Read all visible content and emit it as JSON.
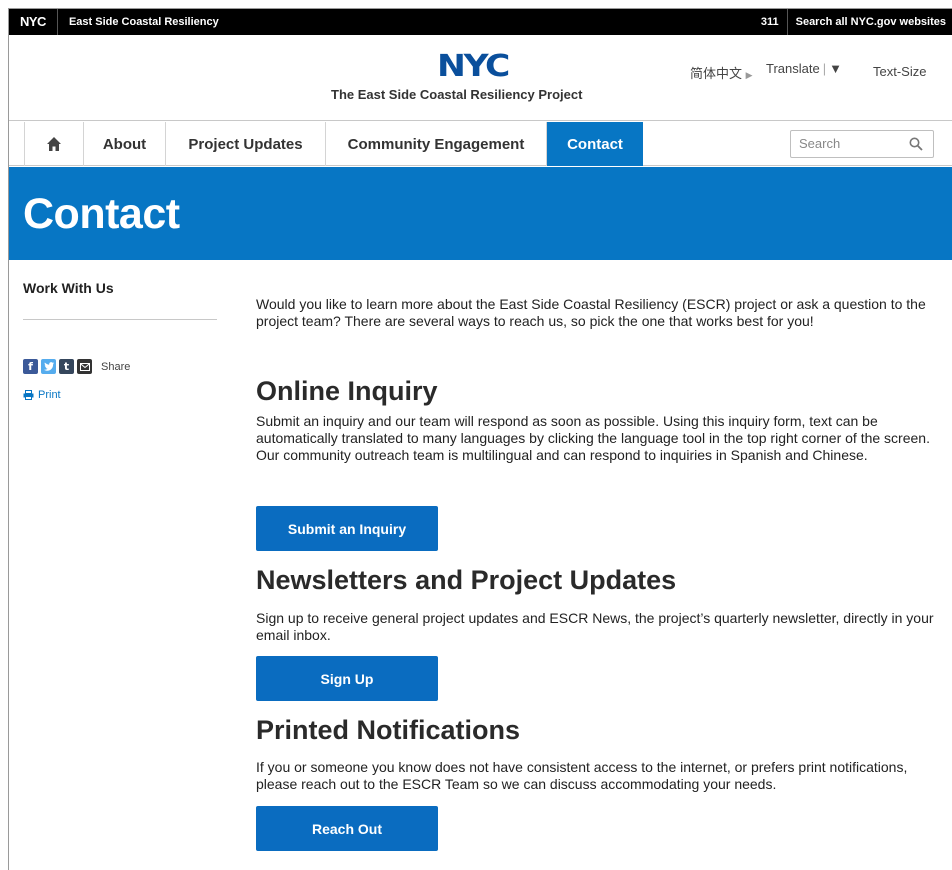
{
  "topbar": {
    "logo": "NYC",
    "site_name": "East Side Coastal Resiliency",
    "link_311": "311",
    "search_all": "Search all NYC.gov websites"
  },
  "header": {
    "logo": "NYC",
    "project_title": "The East Side Coastal Resiliency Project",
    "language": "简体中文",
    "translate": "Translate",
    "text_size": "Text-Size"
  },
  "nav": {
    "items": [
      {
        "label": "About"
      },
      {
        "label": "Project Updates"
      },
      {
        "label": "Community Engagement"
      },
      {
        "label": "Contact"
      }
    ],
    "active": "Contact",
    "search_placeholder": "Search"
  },
  "banner": {
    "title": "Contact"
  },
  "sidebar": {
    "title": "Work With Us",
    "share_label": "Share",
    "print_label": "Print"
  },
  "main": {
    "intro": "Would you like to learn more about the East Side Coastal Resiliency (ESCR) project or ask a question to the project team? There are several ways to reach us, so pick the one that works best for you!",
    "sections": [
      {
        "heading": "Online Inquiry",
        "text": "Submit an inquiry and our team will respond as soon as possible. Using this inquiry form, text can be automatically translated to many languages by clicking the language tool in the top right corner of the screen. Our community outreach team is multilingual and can respond to inquiries in Spanish and Chinese.",
        "button": "Submit an Inquiry"
      },
      {
        "heading": "Newsletters and Project Updates",
        "text": "Sign up to receive general project updates and ESCR News, the project’s quarterly newsletter, directly in your email inbox.",
        "button": "Sign Up"
      },
      {
        "heading": "Printed Notifications",
        "text": "If you or someone you know does not have consistent access to the internet, or prefers print notifications, please reach out to the ESCR Team so we can discuss accommodating your needs.",
        "button": "Reach Out"
      }
    ]
  },
  "colors": {
    "brand_blue": "#0776c4",
    "button_blue": "#0a6cc0",
    "logo_blue": "#0a4f9c",
    "topbar": "#000000"
  }
}
